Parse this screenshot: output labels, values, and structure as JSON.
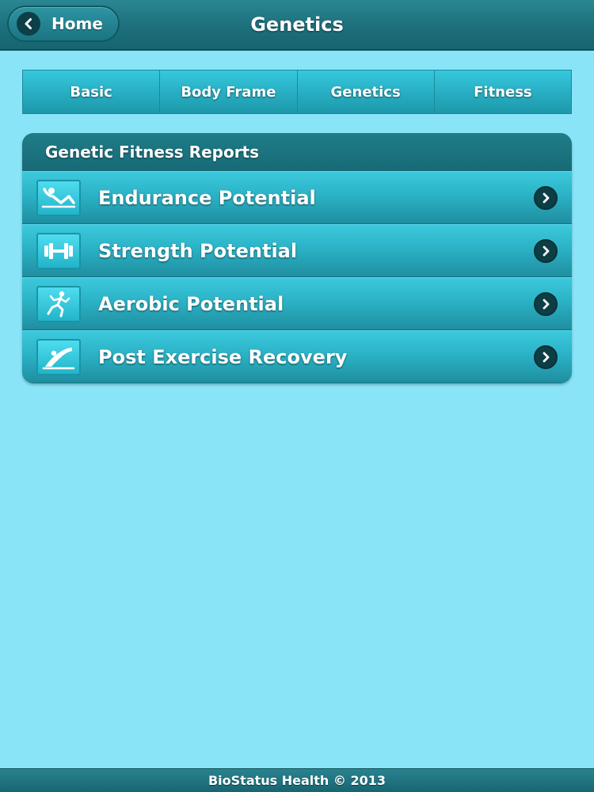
{
  "header": {
    "back_label": "Home",
    "title": "Genetics",
    "back_icon": "chevron-left-icon"
  },
  "tabs": [
    {
      "label": "Basic"
    },
    {
      "label": "Body Frame"
    },
    {
      "label": "Genetics"
    },
    {
      "label": "Fitness"
    }
  ],
  "reports": {
    "title": "Genetic Fitness Reports",
    "items": [
      {
        "label": "Endurance Potential",
        "icon": "situp-icon"
      },
      {
        "label": "Strength Potential",
        "icon": "dumbbell-icon"
      },
      {
        "label": "Aerobic Potential",
        "icon": "runner-icon"
      },
      {
        "label": "Post Exercise Recovery",
        "icon": "recovery-icon"
      }
    ],
    "arrow_icon": "chevron-right-icon"
  },
  "footer": {
    "text": "BioStatus Health © 2013"
  },
  "colors": {
    "background": "#8ae4f8",
    "header": "#1d6f7b",
    "tab": "#2bb2c6",
    "list_item": "#2bb2c6",
    "arrow": "#0d3e45"
  }
}
